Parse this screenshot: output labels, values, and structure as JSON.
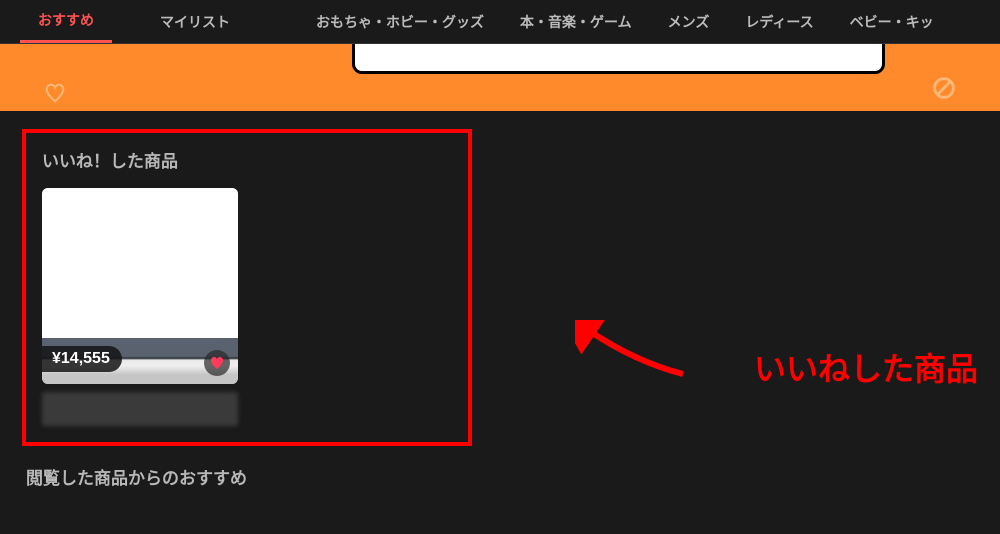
{
  "nav": {
    "items": [
      {
        "label": "おすすめ",
        "active": true
      },
      {
        "label": "マイリスト"
      },
      {
        "label": "おもちゃ・ホビー・グッズ"
      },
      {
        "label": "本・音楽・ゲーム"
      },
      {
        "label": "メンズ"
      },
      {
        "label": "レディース"
      },
      {
        "label": "ベビー・キッ"
      }
    ]
  },
  "liked": {
    "title": "いいね！した商品",
    "product": {
      "price": "¥14,555"
    }
  },
  "rec": {
    "title": "閲覧した商品からのおすすめ"
  },
  "annotation": {
    "text": "いいねした商品"
  }
}
